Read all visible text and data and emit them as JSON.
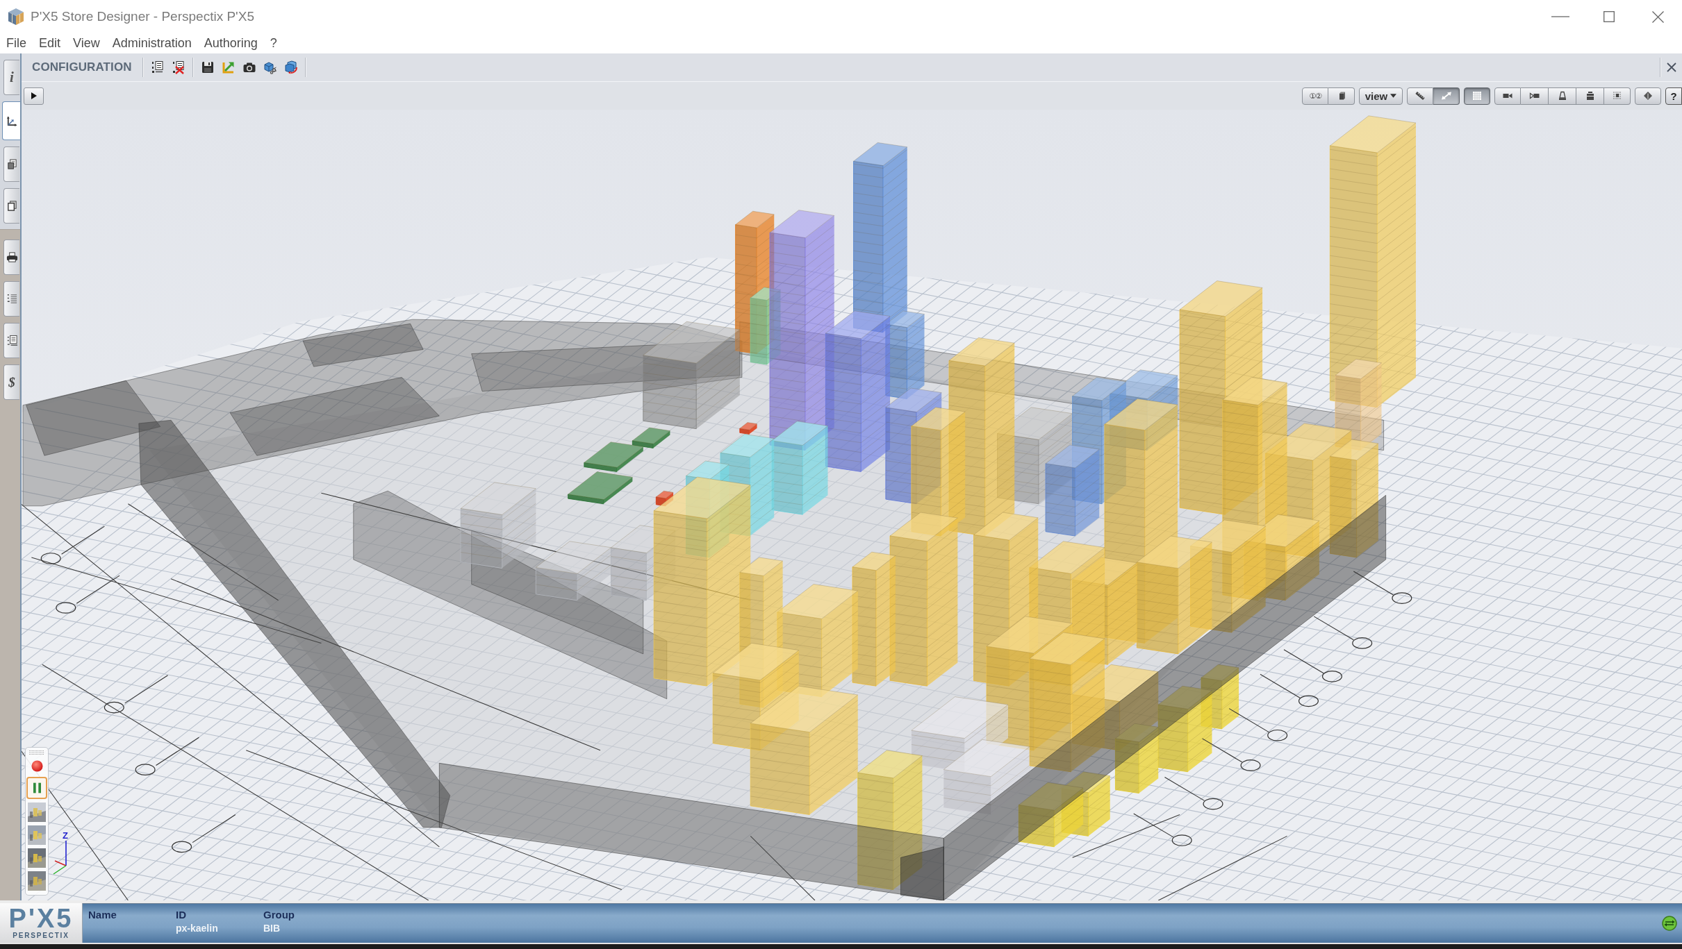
{
  "window": {
    "title": "P'X5 Store Designer - Perspectix P'X5"
  },
  "menu": [
    "File",
    "Edit",
    "View",
    "Administration",
    "Authoring",
    "?"
  ],
  "panel": {
    "title": "CONFIGURATION"
  },
  "side_tabs": [
    {
      "tabs": [
        {
          "kind": "info",
          "label": "i",
          "selected": false
        },
        {
          "kind": "axes",
          "selected": true
        },
        {
          "kind": "document",
          "selected": false
        },
        {
          "kind": "windows",
          "selected": false
        }
      ]
    },
    {
      "tabs": [
        {
          "kind": "printer",
          "selected": false
        },
        {
          "kind": "list",
          "selected": false
        },
        {
          "kind": "list-document",
          "selected": false
        },
        {
          "kind": "currency",
          "label": "$",
          "selected": false
        }
      ]
    }
  ],
  "view_toolbar": {
    "groups": [
      {
        "buttons": [
          {
            "kind": "numbers",
            "label": "①②",
            "pressed": false
          },
          {
            "kind": "solid",
            "pressed": false
          }
        ]
      },
      {
        "buttons": [
          {
            "kind": "dropdown",
            "label": "view",
            "pressed": false
          }
        ]
      },
      {
        "buttons": [
          {
            "kind": "measure",
            "pressed": false
          },
          {
            "kind": "resize",
            "pressed": true
          }
        ]
      },
      {
        "buttons": [
          {
            "kind": "grid",
            "pressed": true
          }
        ]
      },
      {
        "buttons": [
          {
            "kind": "camera-front",
            "pressed": false
          },
          {
            "kind": "camera-back",
            "pressed": false
          },
          {
            "kind": "lamp",
            "pressed": false
          },
          {
            "kind": "weight",
            "pressed": false
          },
          {
            "kind": "pattern",
            "pressed": false
          }
        ]
      },
      {
        "buttons": [
          {
            "kind": "diamond",
            "pressed": false
          }
        ]
      },
      {
        "buttons": [
          {
            "kind": "help",
            "label": "?",
            "pressed": false
          }
        ]
      }
    ]
  },
  "viewport": {
    "playback_controls": [
      {
        "kind": "record",
        "selected": false
      },
      {
        "kind": "pause",
        "selected": true
      }
    ],
    "axis_label": "Z"
  },
  "status_bar": {
    "logo": {
      "mark": "P'X5",
      "subtitle": "PERSPECTIX"
    },
    "fields": [
      {
        "label": "Name"
      },
      {
        "label": "ID",
        "value": "px-kaelin"
      },
      {
        "label": "Group",
        "value": "BIB"
      }
    ]
  }
}
